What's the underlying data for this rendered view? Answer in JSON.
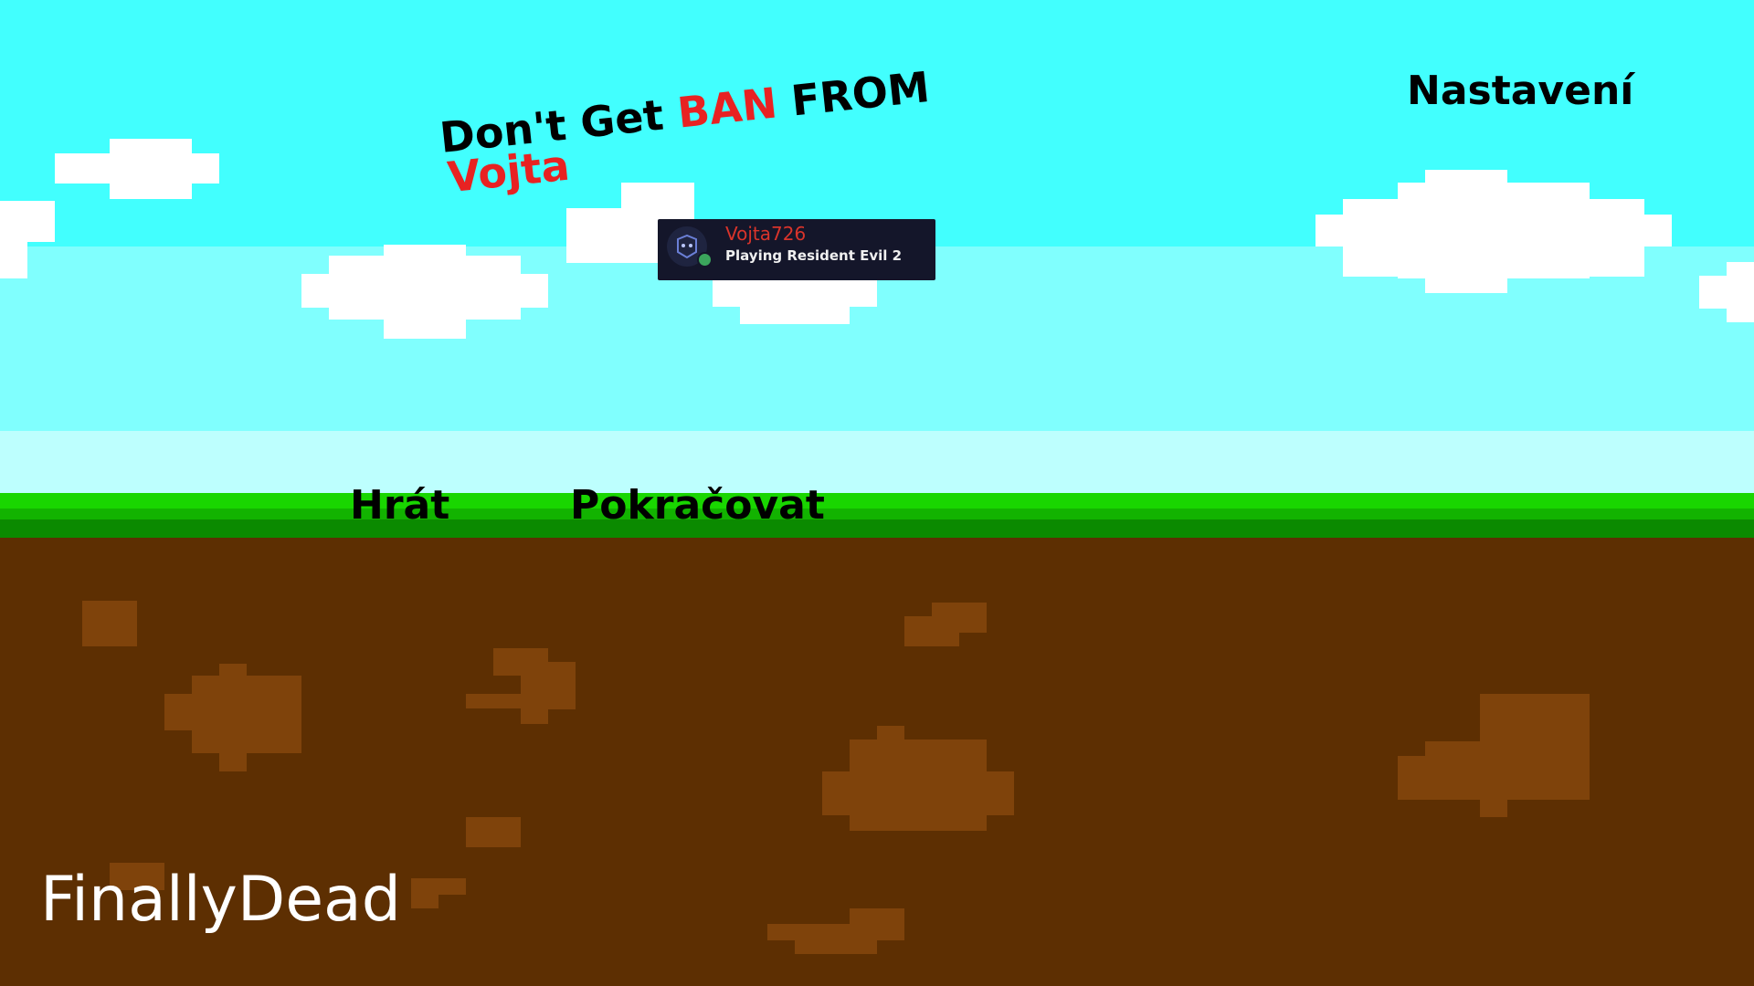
{
  "title": {
    "part1": "Don't Get ",
    "highlight": "BAN",
    "part2": " FROM",
    "line2": "Vojta"
  },
  "menu": {
    "play": "Hrát",
    "continue": "Pokračovat",
    "settings": "Nastavení"
  },
  "discord": {
    "username": "Vojta726",
    "status": "Playing Resident Evil 2",
    "avatar_icon": "discord-avatar-icon",
    "online_color": "#3ba55c"
  },
  "credit": "FinallyDead",
  "colors": {
    "sky_top": "#42fffe",
    "sky_mid": "#80fffe",
    "sky_low": "#bdfffe",
    "grass": "#19d600",
    "dirt": "#5d2f02",
    "dirt_spot": "#7f430b",
    "title_accent": "#e82222"
  }
}
